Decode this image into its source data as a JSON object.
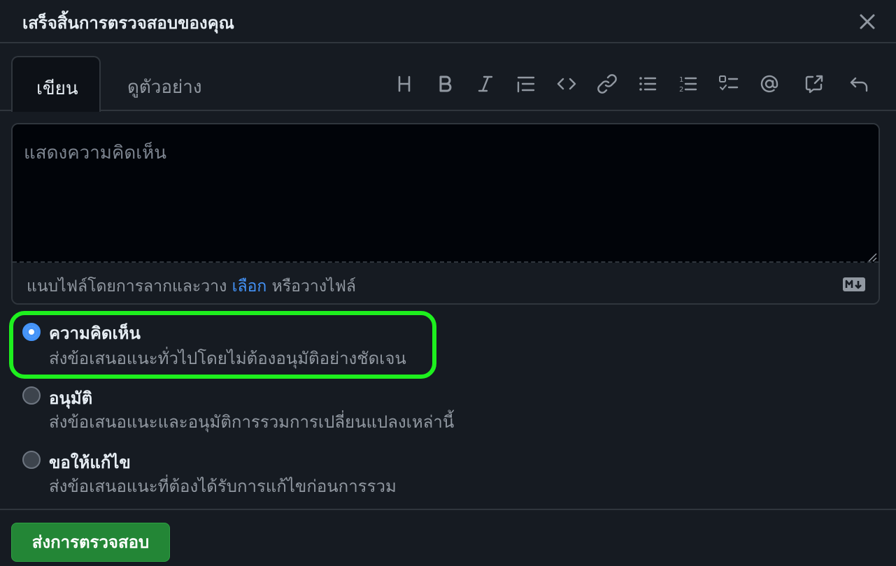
{
  "dialog": {
    "title": "เสร็จสิ้นการตรวจสอบของคุณ",
    "close_icon": "close-icon"
  },
  "tabs": [
    {
      "label": "เขียน",
      "selected": true
    },
    {
      "label": "ดูตัวอย่าง",
      "selected": false
    }
  ],
  "toolbar": {
    "icons": [
      "heading-icon",
      "bold-icon",
      "italic-icon",
      "quote-icon",
      "code-icon",
      "link-icon",
      "unordered-list-icon",
      "ordered-list-icon",
      "task-list-icon",
      "mention-icon",
      "cross-reference-icon",
      "undo-icon"
    ]
  },
  "editor": {
    "placeholder": "แสดงความคิดเห็น",
    "value": "",
    "attach_prefix": "แนบไฟล์โดยการลากและวาง",
    "attach_link": "เลือก",
    "attach_suffix": "หรือวางไฟล์",
    "markdown_icon": "markdown-icon"
  },
  "review_options": [
    {
      "title": "ความคิดเห็น",
      "description": "ส่งข้อเสนอแนะทั่วไปโดยไม่ต้องอนุมัติอย่างชัดเจน",
      "checked": true
    },
    {
      "title": "อนุมัติ",
      "description": "ส่งข้อเสนอแนะและอนุมัติการรวมการเปลี่ยนแปลงเหล่านี้",
      "checked": false
    },
    {
      "title": "ขอให้แก้ไข",
      "description": "ส่งข้อเสนอแนะที่ต้องได้รับการแก้ไขก่อนการรวม",
      "checked": false
    }
  ],
  "footer": {
    "submit_label": "ส่งการตรวจสอบ"
  },
  "colors": {
    "background": "#161b22",
    "editor_background": "#010409",
    "border": "#30363d",
    "link": "#4493f8",
    "submit": "#238636",
    "highlight": "#1ef01e"
  }
}
